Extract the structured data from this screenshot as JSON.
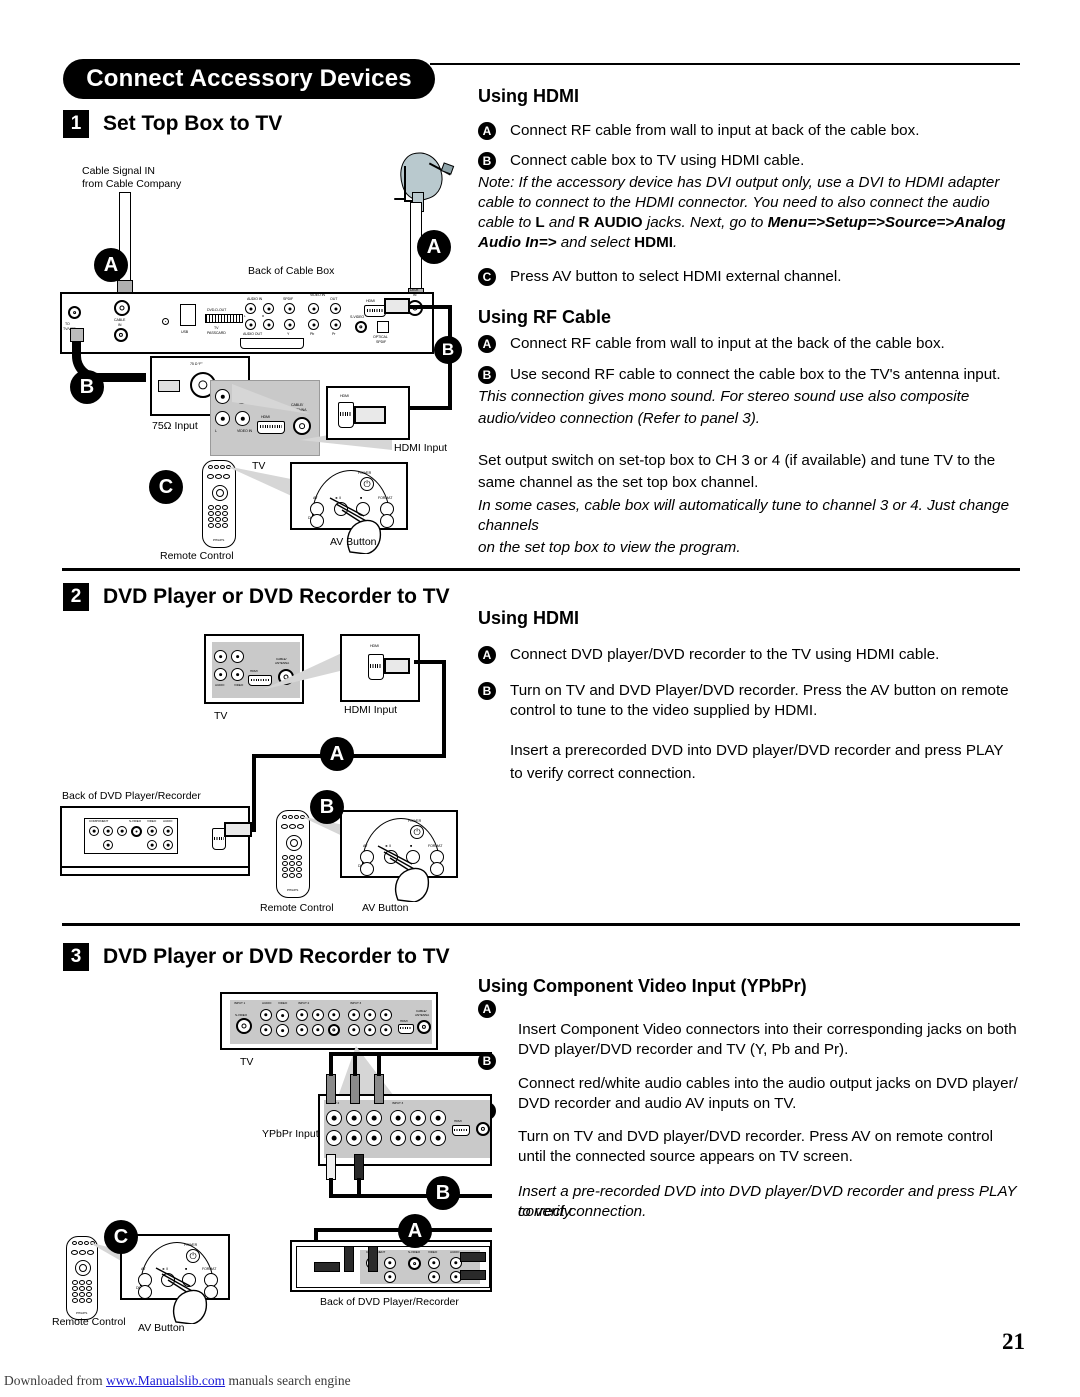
{
  "header": {
    "title": "Connect Accessory Devices"
  },
  "sections": [
    {
      "number": "1",
      "title": "Set Top Box to TV",
      "right": {
        "heading": "Using HDMI",
        "steps": [
          {
            "bullet": "A",
            "text": "Connect RF cable from wall to input at back of the cable box."
          },
          {
            "bullet": "B",
            "text": "Connect cable box to TV using HDMI cable."
          }
        ],
        "note_html": "Note: If the accessory device has DVI output only, use a DVI to HDMI adapter cable to connect to the HDMI connector. You need to also connect the audio cable to <b class=\"nb\">L</b> and <b class=\"nb\">R</b> <b class=\"nb\">AUDIO</b> jacks.  Next, go to <b class=\"ni\">Menu=&gt;Setup=&gt;Source=&gt;Analog Audio In=&gt;</b> and select <b class=\"nb\">HDMI</b>.",
        "step_c": {
          "bullet": "C",
          "text": "Press AV button to select HDMI external channel."
        },
        "heading2": "Using RF Cable",
        "steps2": [
          {
            "bullet": "A",
            "text": "Connect RF cable from wall to input at the back of the cable box."
          },
          {
            "bullet": "B",
            "text": "Use second RF cable to connect the cable box to the TV's antenna input."
          }
        ],
        "note2_line1": "This connection gives mono sound. For stereo sound use also composite",
        "note2_line2": "audio/video connection (Refer to panel 3).",
        "para1_line1": "Set output switch on set-top box to CH 3 or 4 (if available) and tune TV to the",
        "para1_line2": "same channel as the set top box channel.",
        "para2_line1": "In some cases, cable box will automatically tune to channel 3 or 4. Just change channels",
        "para2_line2": "on the set top box to view the program."
      },
      "diagram": {
        "cable_signal_l1": "Cable Signal IN",
        "cable_signal_l2": "from Cable Company",
        "back_of_cable_box": "Back of Cable Box",
        "input_75": "75Ω Input",
        "tv": "TV",
        "hdmi_input": "HDMI Input",
        "remote_control": "Remote Control",
        "av_button": "AV Button",
        "badges": [
          "A",
          "A",
          "B",
          "B",
          "C"
        ],
        "ports": {
          "to_tv_vcr_l1": "TO",
          "to_tv_vcr_l2": "TV/VCR",
          "cable_in_l1": "CABLE",
          "cable_in_l2": "IN",
          "usb": "USB",
          "dvd_d_out": "DVD-D-OUT",
          "tv_passcard_l1": "TV",
          "tv_passcard_l2": "PASSCARD",
          "audio_in": "AUDIO IN",
          "audio_out": "AUDIO OUT",
          "spdif": "SPDIF",
          "video_in": "VIDEO IN",
          "video_out": "OUT",
          "s_video": "S-VIDEO",
          "optical_l1": "OPTICAL",
          "optical_l2": "SPDIF",
          "hdmi": "HDMI",
          "dish_in_l1": "DISH",
          "dish_in_l2": "IN",
          "y": "Y",
          "pb": "Pb",
          "pr": "Pr",
          "l": "L",
          "r": "R",
          "ohm75": "75 Ω “F”",
          "cable_antenna_l1": "CABLE/",
          "cable_antenna_l2": "ANTENNA"
        },
        "remote_keys": {
          "av": "AV",
          "play": "► II",
          "stop": "■",
          "format": "FORMAT",
          "demo": "DEMO",
          "power": "POWER",
          "brand": "PHILIPS"
        }
      }
    },
    {
      "number": "2",
      "title": "DVD Player or DVD Recorder to TV",
      "right": {
        "heading": "Using HDMI",
        "steps": [
          {
            "bullet": "A",
            "text": "Connect DVD player/DVD recorder to the TV using HDMI cable."
          },
          {
            "bullet": "B",
            "text": "Turn on TV and DVD Player/DVD recorder. Press the AV button on remote control to tune to the video supplied by HDMI."
          }
        ],
        "para_line1": "Insert a prerecorded DVD into DVD player/DVD recorder and press PLAY",
        "para_line2": "to verify correct connection."
      },
      "diagram": {
        "tv": "TV",
        "hdmi_input": "HDMI Input",
        "back_of_dvd": "Back of DVD Player/Recorder",
        "remote_control": "Remote Control",
        "av_button": "AV Button",
        "badges": [
          "A",
          "B"
        ],
        "ports": {
          "hdmi": "HDMI",
          "cable_antenna_l1": "CABLE/",
          "cable_antenna_l2": "ANTENNA",
          "component": "COMPONENT",
          "s_video": "S-VIDEO",
          "video": "VIDEO",
          "audio": "AUDIO"
        }
      }
    },
    {
      "number": "3",
      "title": "DVD Player or DVD Recorder to TV",
      "right": {
        "heading": "Using Component Video Input (YPbPr)",
        "steps": [
          {
            "bullet": "A",
            "line1": "Insert Component Video connectors into their corresponding jacks on both",
            "line2": "DVD player/DVD recorder and TV (Y, Pb and Pr)."
          },
          {
            "bullet": "B",
            "line1": "Connect red/white audio cables into the audio output jacks on DVD player/",
            "line2": "DVD recorder and audio AV inputs on TV."
          },
          {
            "bullet": "C",
            "line1": "Turn on TV and DVD player/DVD recorder. Press AV on remote control",
            "line2": "until the connected source appears on TV screen."
          }
        ],
        "note_line1": "Insert a pre-recorded DVD into DVD player/DVD recorder and press PLAY to verify",
        "note_line2": "correct connection."
      },
      "diagram": {
        "tv": "TV",
        "ypbpr_input": "YPbPr Input",
        "back_of_dvd": "Back of DVD Player/Recorder",
        "remote_control": "Remote Control",
        "av_button": "AV Button",
        "badges": [
          "A",
          "B",
          "C"
        ],
        "ports": {
          "input1": "INPUT 1",
          "input2": "INPUT 2",
          "input3": "INPUT 3",
          "s_video": "S-VIDEO",
          "video": "VIDEO",
          "audio": "AUDIO",
          "hdmi": "HDMI",
          "cable_antenna_l1": "CABLE/",
          "cable_antenna_l2": "ANTENNA",
          "component": "COMPONENT",
          "y": "Y",
          "pb": "Pb",
          "pr": "Pr",
          "l": "L",
          "r": "R"
        }
      }
    }
  ],
  "page_number": "21",
  "footer": {
    "before": "Downloaded from ",
    "link": "www.Manualslib.com",
    "after": " manuals search engine"
  },
  "colors": {
    "ink": "#000000",
    "paper": "#ffffff",
    "panel_gray": "#c9c9c9",
    "dish_blue": "#b9c9ce",
    "link_blue": "#1b1bd6"
  }
}
